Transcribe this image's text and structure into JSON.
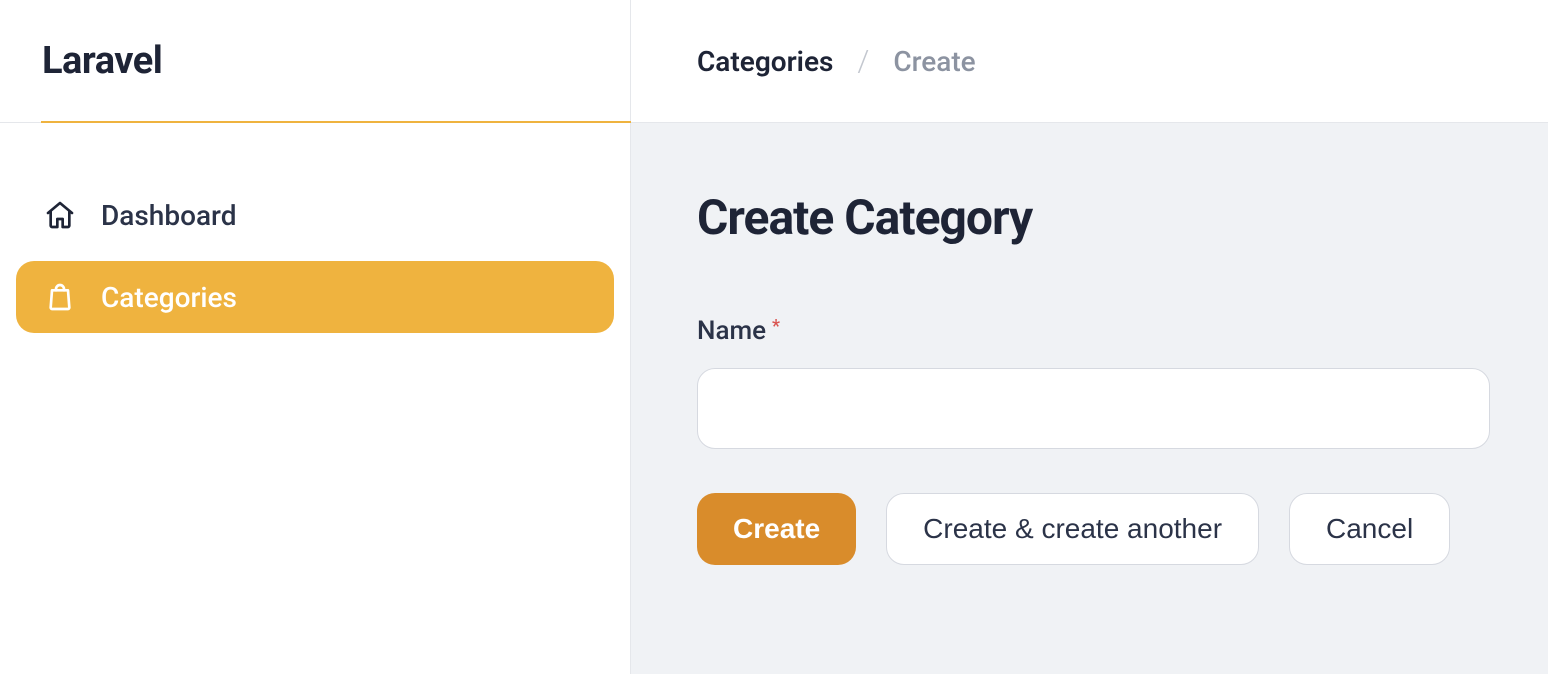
{
  "brand": "Laravel",
  "sidebar": {
    "items": [
      {
        "label": "Dashboard",
        "icon": "home"
      },
      {
        "label": "Categories",
        "icon": "bag",
        "active": true
      }
    ]
  },
  "breadcrumb": {
    "root": "Categories",
    "current": "Create"
  },
  "page": {
    "title": "Create Category"
  },
  "form": {
    "name_label": "Name",
    "name_value": "",
    "required_mark": "*"
  },
  "actions": {
    "create": "Create",
    "create_another": "Create & create another",
    "cancel": "Cancel"
  },
  "colors": {
    "accent": "#efb33f",
    "primary_btn": "#d98c2b",
    "text": "#1e2436",
    "muted": "#8c93a1",
    "border": "#d6d9e0",
    "bg_muted": "#f0f2f5"
  }
}
